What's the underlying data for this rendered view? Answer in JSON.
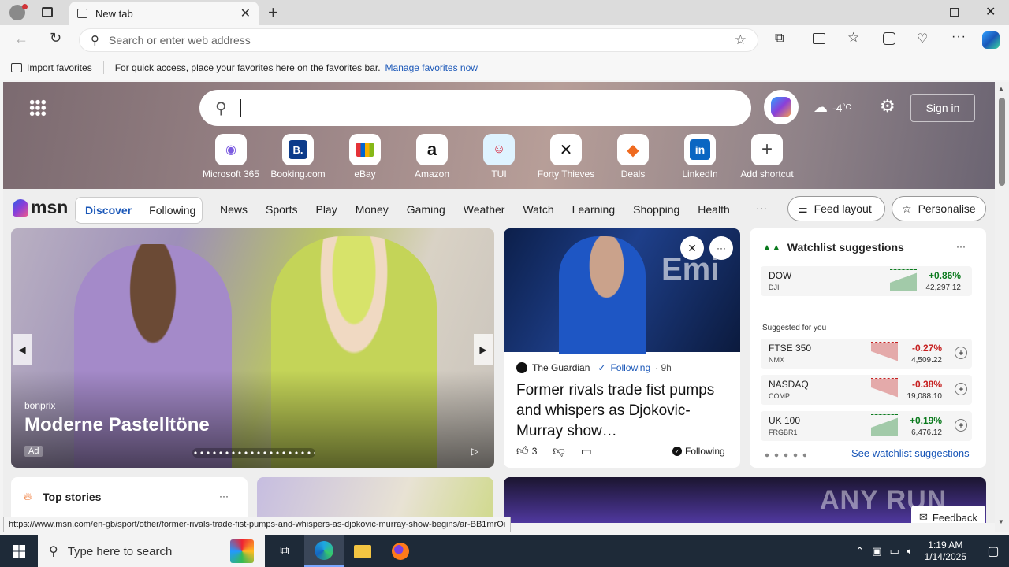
{
  "browser": {
    "tab_title": "New tab",
    "address_placeholder": "Search or enter web address",
    "favbar": {
      "import_label": "Import favorites",
      "message": "For quick access, place your favorites here on the favorites bar.",
      "manage_link": "Manage favorites now"
    }
  },
  "hero": {
    "weather": "-4",
    "weather_unit": "°C",
    "sign_in": "Sign in",
    "shortcuts": [
      "Microsoft 365",
      "Booking.com",
      "eBay",
      "Amazon",
      "TUI",
      "Forty Thieves",
      "Deals",
      "LinkedIn",
      "Add shortcut"
    ]
  },
  "msn": {
    "logo": "msn",
    "feed_tabs": [
      "Discover",
      "Following"
    ],
    "nav": [
      "News",
      "Sports",
      "Play",
      "Money",
      "Gaming",
      "Weather",
      "Watch",
      "Learning",
      "Shopping",
      "Health"
    ],
    "more": "···",
    "feed_layout": "Feed layout",
    "personalise": "Personalise"
  },
  "ad_card": {
    "source": "bonprix",
    "title": "Moderne Pastelltöne",
    "ad_label": "Ad"
  },
  "news_card": {
    "source": "The Guardian",
    "following": "Following",
    "age": "· 9h",
    "headline": "Former rivals trade fist pumps and whispers as Djokovic-Murray show…",
    "likes": "3",
    "following_footer": "Following"
  },
  "watchlist": {
    "title": "Watchlist suggestions",
    "more": "···",
    "suggested_label": "Suggested for you",
    "see_more": "See watchlist suggestions",
    "main": {
      "name": "DOW",
      "sym": "DJI",
      "change": "+0.86%",
      "value": "42,297.12"
    },
    "stocks": [
      {
        "name": "FTSE 350",
        "sym": "NMX",
        "change": "-0.27%",
        "value": "4,509.22",
        "dir": "down"
      },
      {
        "name": "NASDAQ",
        "sym": "COMP",
        "change": "-0.38%",
        "value": "19,088.10",
        "dir": "down"
      },
      {
        "name": "UK 100",
        "sym": "FRGBR1",
        "change": "+0.19%",
        "value": "6,476.12",
        "dir": "up"
      }
    ]
  },
  "top_stories": {
    "title": "Top stories",
    "more": "···"
  },
  "status_url": "https://www.msn.com/en-gb/sport/other/former-rivals-trade-fist-pumps-and-whispers-as-djokovic-murray-show-begins/ar-BB1mrOi",
  "feedback": "Feedback",
  "watermark": "ANY RUN",
  "taskbar": {
    "search_placeholder": "Type here to search",
    "time": "1:19 AM",
    "date": "1/14/2025"
  },
  "colors": {
    "accent": "#1a57b8",
    "up": "#0a7a1d",
    "down": "#c62020"
  }
}
